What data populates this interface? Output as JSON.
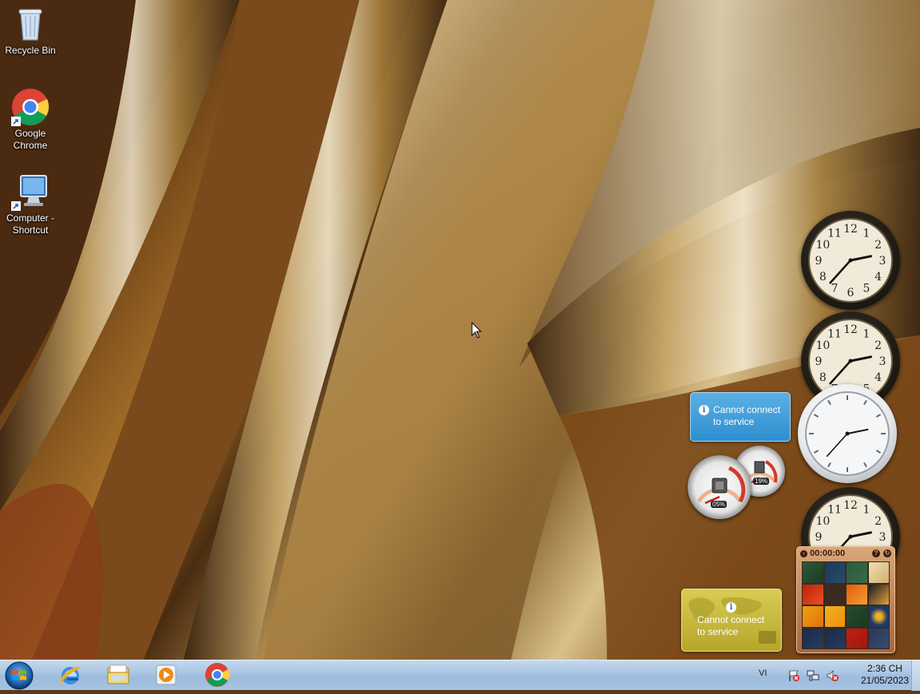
{
  "desktop": {
    "icons": [
      {
        "label": "Recycle Bin",
        "icon": "recycle-bin-icon"
      },
      {
        "label": "Google Chrome",
        "icon": "chrome-icon"
      },
      {
        "label": "Computer - Shortcut",
        "icon": "computer-icon"
      }
    ]
  },
  "gadgets": {
    "weather": {
      "message": "Cannot connect to service"
    },
    "currency": {
      "message": "Cannot connect to service"
    },
    "cpu_meter": {
      "cpu_percent": "05%",
      "memory_percent": "19%"
    },
    "puzzle": {
      "timer": "00:00:00"
    },
    "clocks": [
      {
        "hour": 2,
        "minute": 37
      },
      {
        "hour": 2,
        "minute": 37
      },
      {
        "hour": 2,
        "minute": 37
      },
      {
        "hour": 2,
        "minute": 37
      }
    ]
  },
  "taskbar": {
    "start_icon": "windows-logo-icon",
    "pinned": [
      {
        "name": "Internet Explorer",
        "icon": "internet-explorer-icon"
      },
      {
        "name": "Windows Explorer",
        "icon": "folder-icon"
      },
      {
        "name": "Windows Media Player",
        "icon": "media-player-icon"
      },
      {
        "name": "Google Chrome",
        "icon": "chrome-icon"
      }
    ],
    "tray": {
      "language": "VI",
      "icons": [
        "action-center-flag-icon",
        "network-icon",
        "volume-muted-icon"
      ],
      "time": "2:36 CH",
      "date": "21/05/2023"
    }
  },
  "colors": {
    "taskbar": "#a9c4e2",
    "weather_gadget": "#3a9ad6",
    "currency_gadget": "#c8ba3e"
  }
}
